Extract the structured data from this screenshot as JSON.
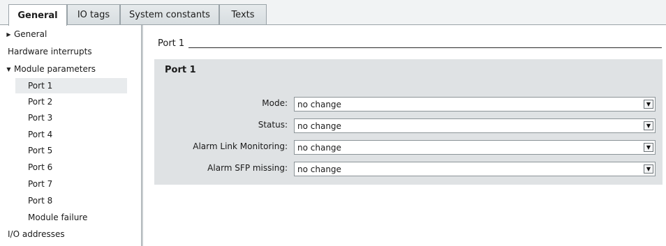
{
  "tabs": [
    {
      "label": "General"
    },
    {
      "label": "IO tags"
    },
    {
      "label": "System constants"
    },
    {
      "label": "Texts"
    }
  ],
  "nav": {
    "items": [
      {
        "label": "General",
        "arrow": "▶"
      },
      {
        "label": "Hardware interrupts"
      },
      {
        "label": "Module parameters",
        "arrow": "▼"
      },
      {
        "label": "Port 1"
      },
      {
        "label": "Port 2"
      },
      {
        "label": "Port 3"
      },
      {
        "label": "Port 4"
      },
      {
        "label": "Port 5"
      },
      {
        "label": "Port 6"
      },
      {
        "label": "Port 7"
      },
      {
        "label": "Port 8"
      },
      {
        "label": "Module failure"
      },
      {
        "label": "I/O addresses"
      }
    ]
  },
  "section": {
    "title": "Port 1"
  },
  "panel": {
    "title": "Port 1",
    "fields": [
      {
        "label": "Mode:",
        "value": "no change"
      },
      {
        "label": "Status:",
        "value": "no change"
      },
      {
        "label": "Alarm Link Monitoring:",
        "value": "no change"
      },
      {
        "label": "Alarm SFP missing:",
        "value": "no change"
      }
    ],
    "dropdown_glyph": "▼"
  },
  "colors": {
    "panel_bg": "#dfe2e4",
    "selected_nav_bg": "#e8ebed",
    "tab_border": "#9aa3a8"
  }
}
